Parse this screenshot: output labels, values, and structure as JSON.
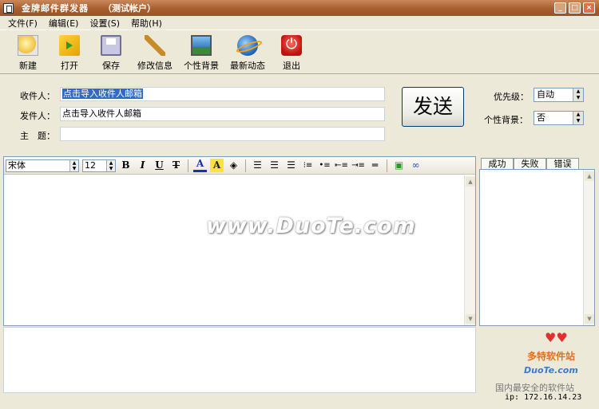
{
  "window": {
    "title": "金牌邮件群发器",
    "subtitle": "（测试帐户）",
    "buttons": {
      "minimize": "_",
      "maximize": "□",
      "close": "×"
    }
  },
  "menu": [
    "文件(F)",
    "编辑(E)",
    "设置(S)",
    "帮助(H)"
  ],
  "toolbar": {
    "new": "新建",
    "open": "打开",
    "save": "保存",
    "edit_info": "修改信息",
    "background": "个性背景",
    "news": "最新动态",
    "exit": "退出"
  },
  "form": {
    "to_label": "收件人：",
    "to_value": "点击导入收件人邮箱",
    "from_label": "发件人：",
    "from_value": "点击导入收件人邮箱",
    "subject_label": "主　题：",
    "subject_value": "",
    "send": "发送",
    "priority_label": "优先级：",
    "priority_value": "自动",
    "bg_label": "个性背景：",
    "bg_value": "否"
  },
  "format": {
    "font": "宋体",
    "size": "12",
    "bold": "B",
    "italic": "I",
    "underline": "U",
    "strike": "T",
    "font_color": "A",
    "highlight": "A"
  },
  "watermark": "www.DuoTe.com",
  "result_tabs": [
    "成功",
    "失败",
    "错误"
  ],
  "logo": {
    "name": "多特软件站",
    "url": "DuoTe.com",
    "slogan": "国内最安全的软件站"
  },
  "ip": "ip: 172.16.14.23"
}
